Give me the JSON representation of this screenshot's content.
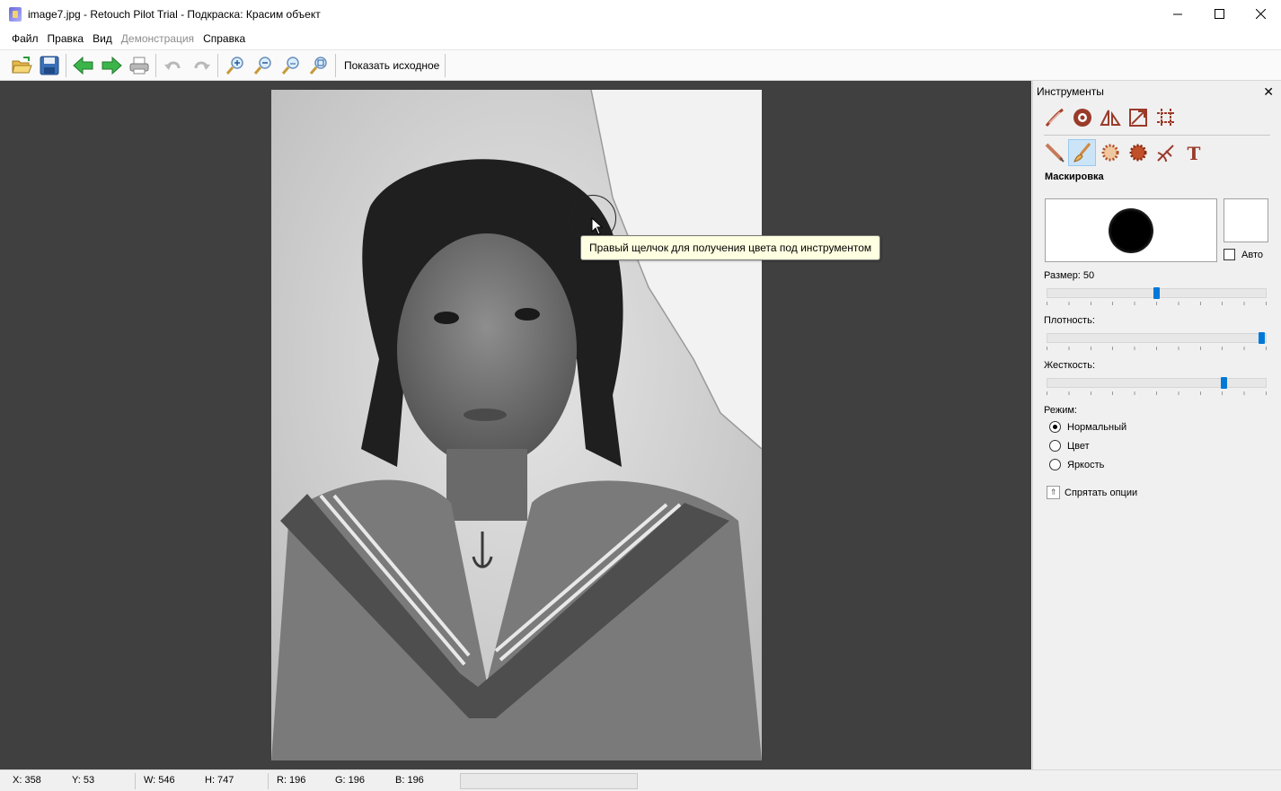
{
  "window": {
    "title": "image7.jpg - Retouch Pilot Trial - Подкраска: Красим объект"
  },
  "menu": {
    "items": [
      "Файл",
      "Правка",
      "Вид",
      "Демонстрация",
      "Справка"
    ]
  },
  "toolbar": {
    "show_original_label": "Показать исходное"
  },
  "canvas": {
    "tooltip": "Правый щелчок для получения цвета под инструментом"
  },
  "panel": {
    "title": "Инструменты",
    "section_title": "Маскировка",
    "auto_label": "Авто",
    "size_label": "Размер: 50",
    "size_value": 50,
    "density_label": "Плотность:",
    "density_value": 100,
    "hardness_label": "Жесткость:",
    "hardness_value": 82,
    "mode_label": "Режим:",
    "modes": [
      "Нормальный",
      "Цвет",
      "Яркость"
    ],
    "selected_mode": "Нормальный",
    "hide_options_label": "Спрятать опции"
  },
  "status": {
    "x": "X: 358",
    "y": "Y: 53",
    "w": "W: 546",
    "h": "H: 747",
    "r": "R: 196",
    "g": "G: 196",
    "b": "B: 196"
  }
}
